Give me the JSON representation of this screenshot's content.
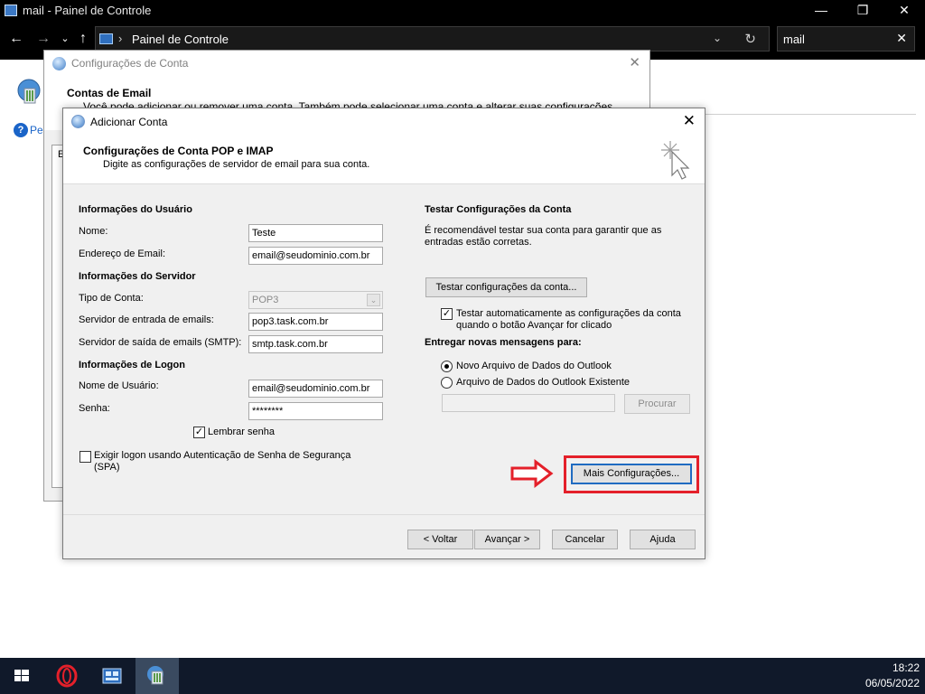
{
  "window": {
    "title": "mail - Painel de Controle",
    "minimize": "—",
    "maximize": "❐",
    "close": "✕"
  },
  "address_bar": {
    "separator": "›",
    "path": "Painel de Controle",
    "dropdown": "⌄",
    "refresh": "↻"
  },
  "search": {
    "value": "mail",
    "clear": "✕"
  },
  "background": {
    "help_partial": "Pes",
    "help_icon": "?"
  },
  "account_window": {
    "title": "Configurações de Conta",
    "close": "✕",
    "heading": "Contas de Email",
    "description": "Você pode adicionar ou remover uma conta. Também pode selecionar uma conta e alterar suas configurações.",
    "panel_tab": "E"
  },
  "dialog": {
    "title": "Adicionar Conta",
    "close": "✕",
    "header_title": "Configurações de Conta POP e IMAP",
    "header_subtitle": "Digite as configurações de servidor de email para sua conta.",
    "user_info": {
      "heading": "Informações do Usuário",
      "name_label": "Nome:",
      "name_value": "Teste",
      "email_label": "Endereço de Email:",
      "email_value": "email@seudominio.com.br"
    },
    "server_info": {
      "heading": "Informações do Servidor",
      "account_type_label": "Tipo de Conta:",
      "account_type_value": "POP3",
      "incoming_label": "Servidor de entrada de emails:",
      "incoming_value": "pop3.task.com.br",
      "outgoing_label": "Servidor de saída de emails (SMTP):",
      "outgoing_value": "smtp.task.com.br"
    },
    "logon_info": {
      "heading": "Informações de Logon",
      "username_label": "Nome de Usuário:",
      "username_value": "email@seudominio.com.br",
      "password_label": "Senha:",
      "password_value": "********",
      "remember_label": "Lembrar senha",
      "remember_checked": true,
      "spa_label": "Exigir logon usando Autenticação de Senha de Segurança (SPA)",
      "spa_checked": false
    },
    "test": {
      "heading": "Testar Configurações da Conta",
      "description": "É recomendável testar sua conta para garantir que as entradas estão corretas.",
      "test_button": "Testar configurações da conta...",
      "auto_test_label": "Testar automaticamente as configurações da conta quando o botão Avançar for clicado",
      "auto_test_checked": true
    },
    "deliver": {
      "heading": "Entregar novas mensagens para:",
      "new_file_label": "Novo Arquivo de Dados do Outlook",
      "existing_file_label": "Arquivo de Dados do Outlook Existente",
      "selected": "new",
      "browse_button": "Procurar"
    },
    "more_settings_button": "Mais Configurações...",
    "footer": {
      "back": "< Voltar",
      "next": "Avançar >",
      "cancel": "Cancelar",
      "help": "Ajuda"
    }
  },
  "taskbar": {
    "time": "18:22",
    "date": "06/05/2022"
  },
  "colors": {
    "highlight": "#e4202a",
    "accent": "#1f6bc1",
    "taskbar": "#10192a"
  }
}
